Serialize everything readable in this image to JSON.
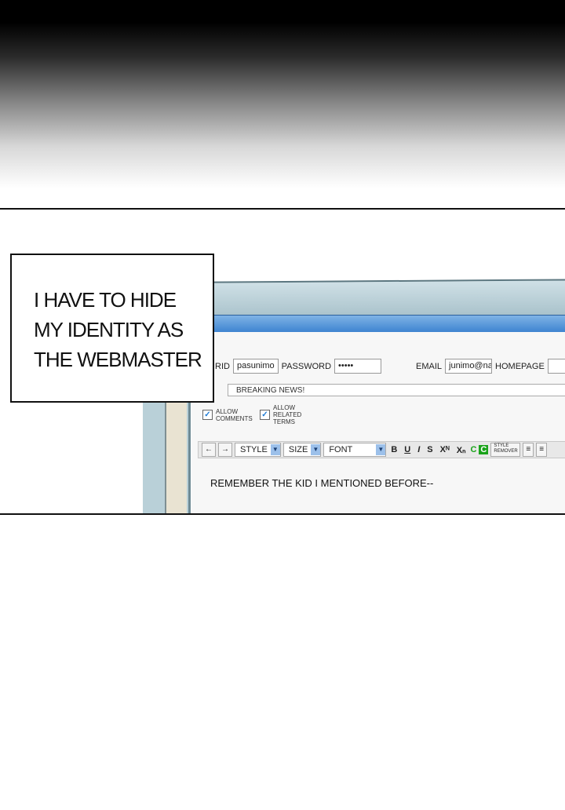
{
  "caption": {
    "lines": [
      "I HAVE TO HIDE",
      "MY IDENTITY AS",
      "THE WEBMASTER"
    ]
  },
  "form": {
    "id_label": "RID",
    "id_value": "pasunimo",
    "password_label": "PASSWORD",
    "password_value": "•••••",
    "email_label": "EMAIL",
    "email_value": "junimo@na",
    "homepage_label": "HOMEPAGE",
    "homepage_value": "",
    "subject_value": "BREAKING NEWS!",
    "allow_comments": "ALLOW COMMENTS",
    "allow_related": "ALLOW RELATED TERMS"
  },
  "toolbar": {
    "back": "←",
    "forward": "→",
    "style": "STYLE",
    "size": "SIZE",
    "font": "FONT",
    "bold": "B",
    "underline": "U",
    "italic": "I",
    "strike": "S",
    "superscript": "Xᴺ",
    "subscript": "Xₙ",
    "color": "C",
    "bgcolor": "C",
    "style_remover": "STYLE REMOVER"
  },
  "editor": {
    "body_text": "REMEMBER THE KID I MENTIONED BEFORE--"
  }
}
